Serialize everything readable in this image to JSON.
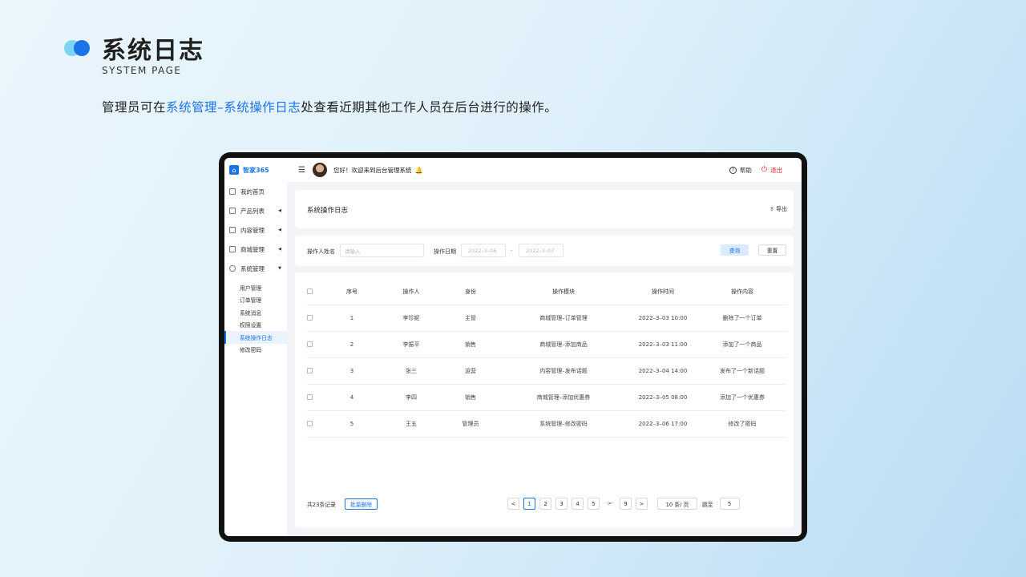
{
  "slide": {
    "title": "系统日志",
    "subtitle": "SYSTEM PAGE",
    "desc_prefix": "管理员可在",
    "desc_highlight": "系统管理–系统操作日志",
    "desc_suffix": "处查看近期其他工作人员在后台进行的操作。"
  },
  "app": {
    "brand": "智家365",
    "welcome": "您好！欢迎来到后台管理系统",
    "help": "帮助",
    "logout": "退出"
  },
  "sidebar": {
    "items": [
      {
        "label": "我的首页"
      },
      {
        "label": "产品列表"
      },
      {
        "label": "内容管理"
      },
      {
        "label": "商城管理"
      },
      {
        "label": "系统管理"
      }
    ],
    "sub_items": [
      {
        "label": "用户管理"
      },
      {
        "label": "订单管理"
      },
      {
        "label": "系统消息"
      },
      {
        "label": "权限设置"
      },
      {
        "label": "系统操作日志"
      },
      {
        "label": "修改密码"
      }
    ]
  },
  "header_card": {
    "title": "系统操作日志",
    "export": "导出"
  },
  "filter": {
    "name_label": "操作人姓名",
    "name_placeholder": "请输入",
    "date_label": "操作日期",
    "date_start": "2022–3–06",
    "date_sep": "-",
    "date_end": "2022–3–07",
    "query": "查询",
    "reset": "重置"
  },
  "table": {
    "headers": [
      "序号",
      "操作人",
      "身份",
      "操作模块",
      "操作时间",
      "操作内容"
    ],
    "rows": [
      [
        "1",
        "李珍妮",
        "主管",
        "商城管理–订单管理",
        "2022–3–03 10:00",
        "删除了一个订单"
      ],
      [
        "2",
        "李振平",
        "销售",
        "商城管理–添加商品",
        "2022–3–03 11:00",
        "添加了一个商品"
      ],
      [
        "3",
        "张三",
        "运营",
        "内容管理–发布话题",
        "2022–3–04 14:00",
        "发布了一个新话题"
      ],
      [
        "4",
        "李四",
        "销售",
        "商城管理–添加优惠券",
        "2022–3–05 08:00",
        "添加了一个优惠券"
      ],
      [
        "5",
        "王五",
        "管理员",
        "系统管理–修改密码",
        "2022–3–06 17:00",
        "修改了密码"
      ]
    ]
  },
  "footer": {
    "total": "共23条记录",
    "batch_delete": "批量删除",
    "prev": "<",
    "pages": [
      "1",
      "2",
      "3",
      "4",
      "5"
    ],
    "ellipsis": "·>·",
    "last_page": "9",
    "next": ">",
    "page_size": "10 条/ 页",
    "jump_label": "跳至",
    "jump_value": "5"
  },
  "colors": {
    "accent": "#1a74e8",
    "logout": "#e02020"
  }
}
